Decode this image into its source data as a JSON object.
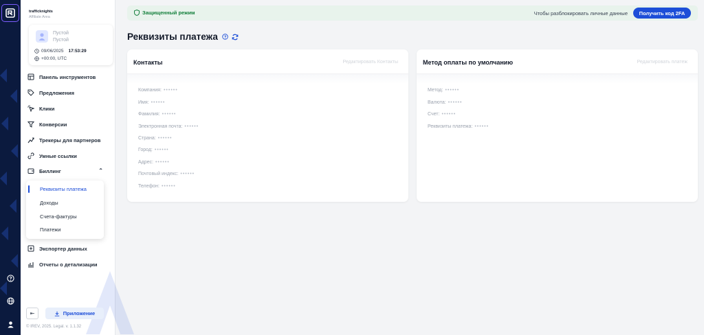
{
  "brand": {
    "name": "trafficknights",
    "subtitle": "Affiliate Area"
  },
  "user": {
    "name_line1": "Пустой",
    "name_line2": "Пустой",
    "date": "09/06/2025",
    "time": "17:53:29",
    "timezone": "+00:00, UTC"
  },
  "nav": {
    "items": [
      {
        "label": "Панель инструментов",
        "icon": "dashboard-icon"
      },
      {
        "label": "Предложения",
        "icon": "tag-icon"
      },
      {
        "label": "Клики",
        "icon": "click-icon"
      },
      {
        "label": "Конверсии",
        "icon": "filter-icon"
      },
      {
        "label": "Трекеры для партнеров",
        "icon": "tracker-icon"
      },
      {
        "label": "Умные ссылки",
        "icon": "link-icon"
      },
      {
        "label": "Биллинг",
        "icon": "wallet-icon"
      },
      {
        "label": "Экспортер данных",
        "icon": "export-icon"
      },
      {
        "label": "Отчеты о детализации",
        "icon": "report-icon"
      }
    ],
    "billing_submenu": [
      {
        "label": "Реквизиты платежа",
        "active": true
      },
      {
        "label": "Доходы"
      },
      {
        "label": "Счета-фактуры"
      },
      {
        "label": "Платежи"
      }
    ]
  },
  "sidebar_footer": {
    "app_button": "Приложение",
    "copyright": "© IREV, 2025. Legal. v. 1.1.32"
  },
  "banner": {
    "protected_label": "Защищенный режим",
    "unlock_text": "Чтобы разблокировать личные данные",
    "button": "Получить код 2FA"
  },
  "page": {
    "title": "Реквизиты платежа"
  },
  "contacts_card": {
    "title": "Контакты",
    "action": "Редактировать Контакты",
    "fields": [
      {
        "label": "Компания:",
        "value": "••••••"
      },
      {
        "label": "Имя:",
        "value": "••••••"
      },
      {
        "label": "Фамилия:",
        "value": "••••••"
      },
      {
        "label": "Электронная почта:",
        "value": "••••••"
      },
      {
        "label": "Страна:",
        "value": "••••••"
      },
      {
        "label": "Город:",
        "value": "••••••"
      },
      {
        "label": "Адрес:",
        "value": "••••••"
      },
      {
        "label": "Почтовый индекс:",
        "value": "••••••"
      },
      {
        "label": "Телефон:",
        "value": "••••••"
      }
    ]
  },
  "payment_card": {
    "title": "Метод оплаты по умолчанию",
    "action": "Редактировать платеж",
    "fields": [
      {
        "label": "Метод:",
        "value": "••••••"
      },
      {
        "label": "Валюта:",
        "value": "••••••"
      },
      {
        "label": "Счет:",
        "value": "••••••"
      },
      {
        "label": "Реквизиты платежа:",
        "value": "••••••"
      }
    ]
  },
  "colors": {
    "rail": "#0b1a3e",
    "accent": "#1d4ed8",
    "success": "#15803d",
    "banner_bg": "#e8f3ec"
  }
}
